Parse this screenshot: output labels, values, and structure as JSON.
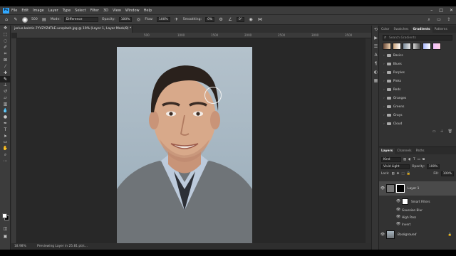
{
  "menu": {
    "logo": "Ps",
    "items": [
      "File",
      "Edit",
      "Image",
      "Layer",
      "Type",
      "Select",
      "Filter",
      "3D",
      "View",
      "Window",
      "Help"
    ]
  },
  "options": {
    "brush_size": "500",
    "mode_label": "Mode:",
    "mode_value": "Difference",
    "opacity_label": "Opacity:",
    "opacity_value": "100%",
    "flow_label": "Flow:",
    "flow_value": "100%",
    "smoothing_label": "Smoothing:",
    "smoothing_value": "0%",
    "angle_value": "0°"
  },
  "document": {
    "tab_title": "jorius-kolstic-7YVZYZdTkE-unsplash.jpg @ 19% (Layer 1, Layer Mask/8) *",
    "ruler_ticks": [
      "500",
      "1000",
      "1500",
      "2000",
      "2500",
      "3000",
      "3500",
      "4000"
    ],
    "zoom": "18.98%",
    "status_text": "Previewing Layer in 25.81 pt/s..."
  },
  "panels": {
    "top_tabs": [
      "Color",
      "Swatches",
      "Gradients",
      "Patterns"
    ],
    "active_top_tab": "Gradients",
    "search_placeholder": "Search Gradients",
    "gradient_swatches": [
      "#6b4c3b",
      "#c9a27a",
      "#7a8a9a",
      "#d8d8d8",
      "#a9b8ff",
      "#f0c0ff"
    ],
    "folders": [
      "Basics",
      "Blues",
      "Purples",
      "Pinks",
      "Reds",
      "Oranges",
      "Greens",
      "Grays",
      "Cloud"
    ],
    "layers_tabs": [
      "Layers",
      "Channels",
      "Paths"
    ],
    "active_layers_tab": "Layers",
    "kind_label": "Kind",
    "blend_mode": "Vivid Light",
    "opacity_label": "Opacity:",
    "opacity_value": "100%",
    "lock_label": "Lock:",
    "fill_label": "Fill:",
    "fill_value": "100%",
    "layers": [
      {
        "name": "Layer 1"
      },
      {
        "name": "Smart Filters"
      },
      {
        "name": "Gaussian Blur"
      },
      {
        "name": "High Pass"
      },
      {
        "name": "Invert"
      },
      {
        "name": "Background"
      }
    ]
  },
  "colors": {
    "accent": "#31a8ff",
    "panel_bg": "#323232",
    "canvas_bg": "#282828"
  }
}
